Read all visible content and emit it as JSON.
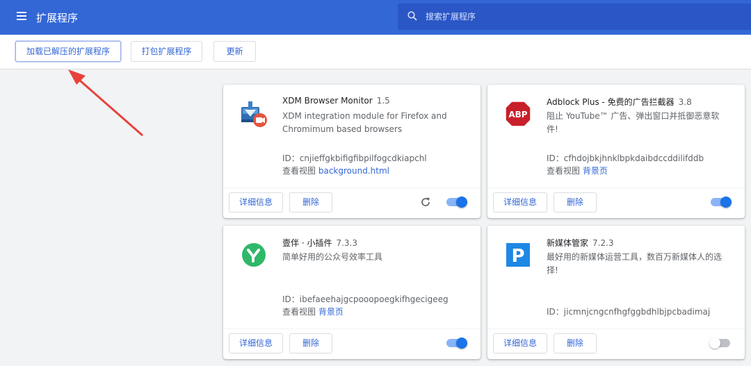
{
  "header": {
    "title": "扩展程序",
    "search_placeholder": "搜索扩展程序"
  },
  "toolbar": {
    "load_unpacked": "加载已解压的扩展程序",
    "pack": "打包扩展程序",
    "update": "更新"
  },
  "colors": {
    "header": "#3367d6",
    "accent": "#3367d6",
    "toggle_on": "#1a73e8"
  },
  "cards": [
    {
      "name": "XDM Browser Monitor",
      "version": "1.5",
      "description": "XDM integration module for Firefox and Chromimum based browsers",
      "id_label": "ID：cnjieffgkbifigfibpilfogcdkiapchl",
      "views_label": "查看视图",
      "views_link": "background.html",
      "details": "详细信息",
      "remove": "删除",
      "enabled": true,
      "icon": "xdm-icon"
    },
    {
      "name": "Adblock Plus - 免费的广告拦截器",
      "version": "3.8",
      "description": "阻止 YouTube™ 广告、弹出窗口并抵御恶意软件!",
      "id_label": "ID：cfhdojbkjhnklbpkdaibdccddilifddb",
      "views_label": "查看视图",
      "views_link": "背景页",
      "details": "详细信息",
      "remove": "删除",
      "enabled": true,
      "icon": "abp-icon",
      "icon_text": "ABP"
    },
    {
      "name": "壹伴 · 小插件",
      "version": "7.3.3",
      "description": "简单好用的公众号效率工具",
      "id_label": "ID：ibefaeehajgcpooopoegkifhgecigeeg",
      "views_label": "查看视图",
      "views_link": "背景页",
      "details": "详细信息",
      "remove": "删除",
      "enabled": true,
      "icon": "yiban-icon"
    },
    {
      "name": "新媒体管家",
      "version": "7.2.3",
      "description": "最好用的新媒体运营工具，数百万新媒体人的选择!",
      "id_label": "ID：jicmnjcngcnfhgfggbdhlbjpcbadimaj",
      "details": "详细信息",
      "remove": "删除",
      "enabled": false,
      "icon": "p-icon",
      "icon_text": "P"
    }
  ]
}
